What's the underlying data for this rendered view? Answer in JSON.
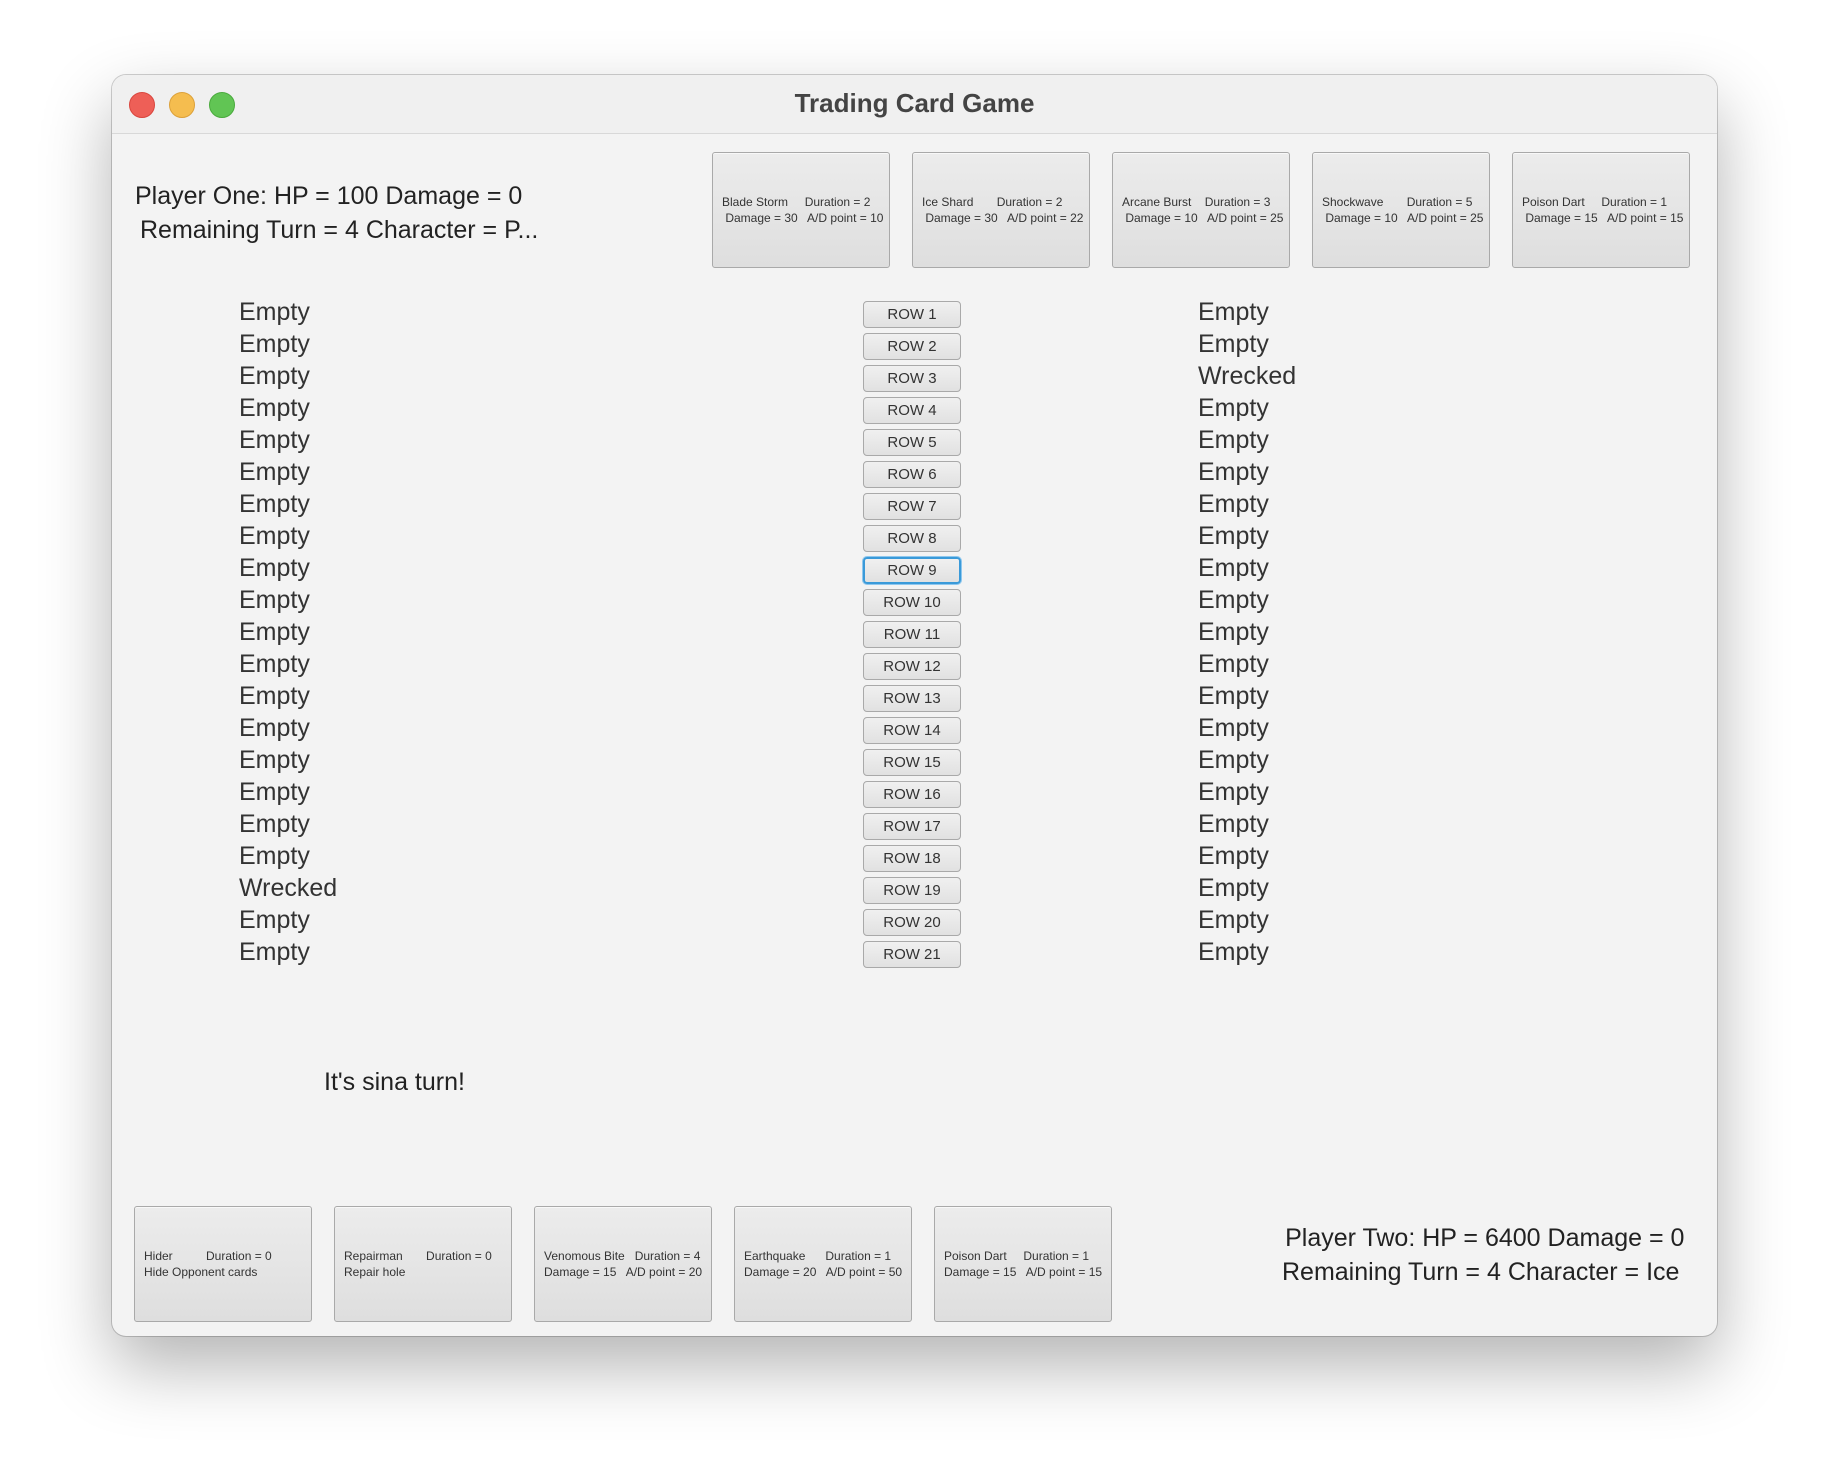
{
  "window": {
    "title": "Trading Card Game"
  },
  "player_one": {
    "line1": "Player One:  HP = 100 Damage = 0",
    "line2": "Remaining Turn = 4 Character = P..."
  },
  "player_two": {
    "line1": "Player Two:  HP = 6400 Damage = 0",
    "line2": "Remaining Turn = 4 Character = Ice"
  },
  "top_cards": [
    {
      "l1": "Blade Storm     Duration = 2",
      "l2": " Damage = 30   A/D point = 10"
    },
    {
      "l1": "Ice Shard       Duration = 2",
      "l2": " Damage = 30   A/D point = 22"
    },
    {
      "l1": "Arcane Burst    Duration = 3",
      "l2": " Damage = 10   A/D point = 25"
    },
    {
      "l1": "Shockwave       Duration = 5",
      "l2": " Damage = 10   A/D point = 25"
    },
    {
      "l1": "Poison Dart     Duration = 1",
      "l2": " Damage = 15   A/D point = 15"
    }
  ],
  "bottom_cards": [
    {
      "l1": "Hider          Duration = 0",
      "l2": "Hide Opponent cards"
    },
    {
      "l1": "Repairman       Duration = 0",
      "l2": "Repair hole"
    },
    {
      "l1": "Venomous Bite   Duration = 4",
      "l2": "Damage = 15   A/D point = 20"
    },
    {
      "l1": "Earthquake      Duration = 1",
      "l2": "Damage = 20   A/D point = 50"
    },
    {
      "l1": "Poison Dart     Duration = 1",
      "l2": "Damage = 15   A/D point = 15"
    }
  ],
  "left_rows": [
    "Empty",
    "Empty",
    "Empty",
    "Empty",
    "Empty",
    "Empty",
    "Empty",
    "Empty",
    "Empty",
    "Empty",
    "Empty",
    "Empty",
    "Empty",
    "Empty",
    "Empty",
    "Empty",
    "Empty",
    "Empty",
    "Wrecked",
    "Empty",
    "Empty"
  ],
  "row_buttons": [
    "ROW 1",
    "ROW 2",
    "ROW 3",
    "ROW 4",
    "ROW 5",
    "ROW 6",
    "ROW 7",
    "ROW 8",
    "ROW 9",
    "ROW 10",
    "ROW 11",
    "ROW 12",
    "ROW 13",
    "ROW 14",
    "ROW 15",
    "ROW 16",
    "ROW 17",
    "ROW 18",
    "ROW 19",
    "ROW 20",
    "ROW 21"
  ],
  "focused_row": 9,
  "right_rows": [
    "Empty",
    "Empty",
    "Wrecked",
    "Empty",
    "Empty",
    "Empty",
    "Empty",
    "Empty",
    "Empty",
    "Empty",
    "Empty",
    "Empty",
    "Empty",
    "Empty",
    "Empty",
    "Empty",
    "Empty",
    "Empty",
    "Empty",
    "Empty",
    "Empty"
  ],
  "turn_message": "It's sina turn!"
}
